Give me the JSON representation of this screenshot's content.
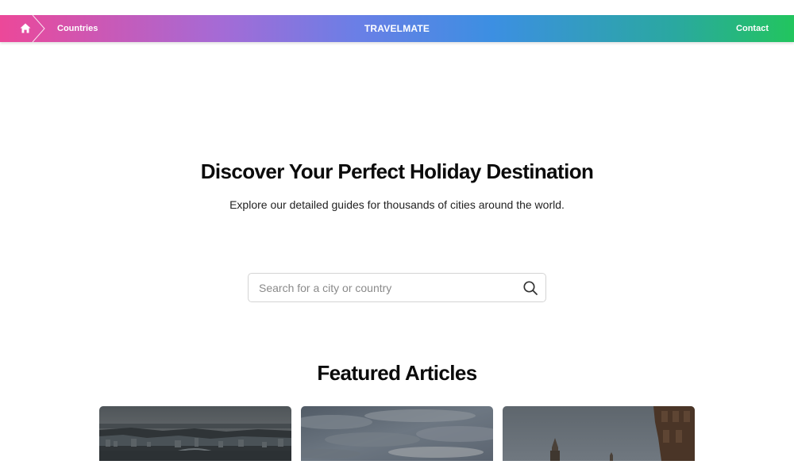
{
  "nav": {
    "home_icon": "home-icon",
    "breadcrumb": "Countries",
    "brand": "TRAVELMATE",
    "contact": "Contact",
    "gradient": [
      "#ec4899",
      "#6a7fe6",
      "#3c8fe2",
      "#22c55e"
    ]
  },
  "hero": {
    "title": "Discover Your Perfect Holiday Destination",
    "subtitle": "Explore our detailed guides for thousands of cities around the world."
  },
  "search": {
    "placeholder": "Search for a city or country",
    "value": "",
    "icon": "search-icon"
  },
  "featured": {
    "title": "Featured Articles",
    "articles": [
      {
        "image": "city-harbor-aerial-photo"
      },
      {
        "image": "cloudy-sky-photo"
      },
      {
        "image": "cathedral-tower-photo"
      }
    ]
  }
}
